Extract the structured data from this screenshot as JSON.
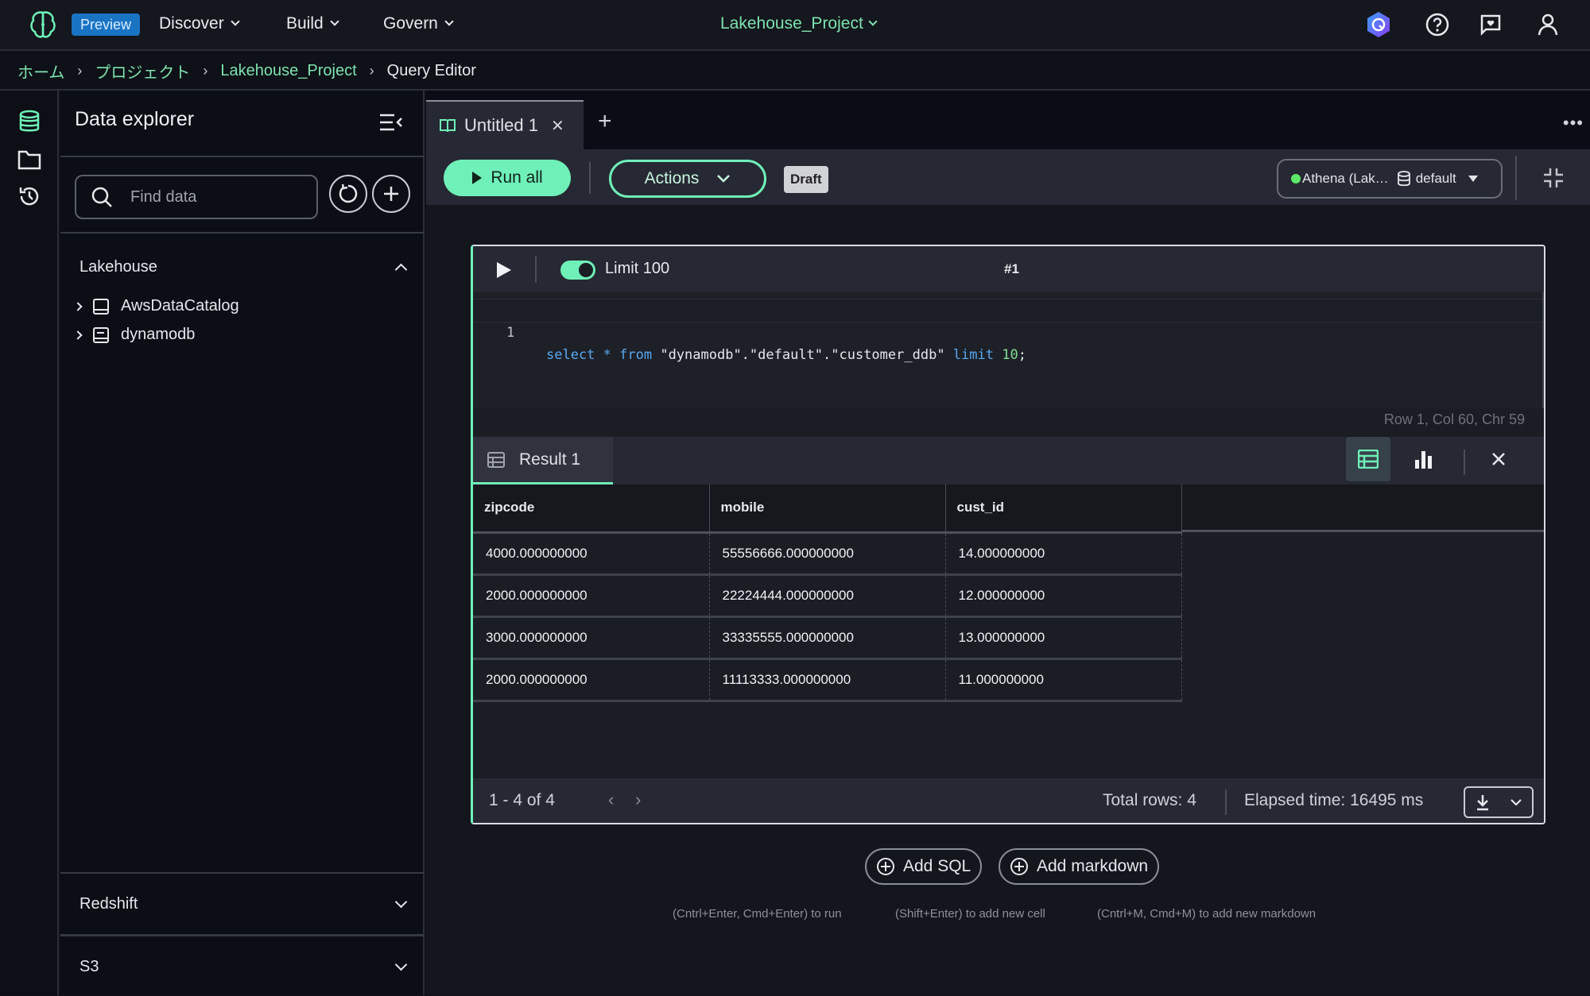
{
  "topbar": {
    "preview_badge": "Preview",
    "menus": [
      {
        "label": "Discover"
      },
      {
        "label": "Build"
      },
      {
        "label": "Govern"
      }
    ],
    "project": "Lakehouse_Project",
    "icons": [
      "app-logo-icon",
      "assistant-icon",
      "help-icon",
      "feedback-icon",
      "user-icon"
    ]
  },
  "breadcrumb": [
    {
      "label": "ホーム"
    },
    {
      "label": "プロジェクト"
    },
    {
      "label": "Lakehouse_Project"
    },
    {
      "label": "Query Editor"
    }
  ],
  "rail": {
    "icons": [
      "database-icon",
      "folder-icon",
      "history-icon"
    ],
    "active": "database-icon"
  },
  "explorer": {
    "title": "Data explorer",
    "search_placeholder": "Find data",
    "sections": [
      {
        "label": "Lakehouse",
        "expanded": true,
        "items": [
          {
            "label": "AwsDataCatalog"
          },
          {
            "label": "dynamodb"
          }
        ]
      },
      {
        "label": "Redshift",
        "expanded": false
      },
      {
        "label": "S3",
        "expanded": false
      }
    ]
  },
  "tabs": [
    {
      "label": "Untitled 1",
      "active": true
    }
  ],
  "toolbar": {
    "run_all": "Run all",
    "actions": "Actions",
    "status_badge": "Draft",
    "engine": "Athena (Lak…",
    "database": "default"
  },
  "cell": {
    "limit_enabled": true,
    "limit_label": "Limit 100",
    "cell_number": "#1",
    "code": {
      "line_number": "1",
      "tokens": {
        "kw1": "select",
        "star": " * ",
        "kw2": "from",
        "table": " \"dynamodb\".\"default\".\"customer_ddb\" ",
        "kw3": "limit",
        "num": " 10",
        "semi": ";"
      }
    },
    "cursor_position": "Row 1,  Col 60,  Chr 59",
    "result_tab": "Result 1",
    "result_view": "table",
    "table": {
      "columns": [
        "zipcode",
        "mobile",
        "cust_id"
      ],
      "rows": [
        [
          "4000.000000000",
          "55556666.000000000",
          "14.000000000"
        ],
        [
          "2000.000000000",
          "22224444.000000000",
          "12.000000000"
        ],
        [
          "3000.000000000",
          "33335555.000000000",
          "13.000000000"
        ],
        [
          "2000.000000000",
          "11113333.000000000",
          "11.000000000"
        ]
      ]
    },
    "footer": {
      "page_info": "1 - 4 of 4",
      "total_rows": "Total rows: 4",
      "elapsed": "Elapsed time: 16495 ms"
    }
  },
  "add_buttons": {
    "sql": "Add SQL",
    "markdown": "Add markdown"
  },
  "hints": [
    "(Cntrl+Enter, Cmd+Enter) to run",
    "(Shift+Enter) to add new cell",
    "(Cntrl+M, Cmd+M) to add new markdown"
  ],
  "colors": {
    "accent": "#6ff0b8",
    "link": "#7ee2b0",
    "preview": "#1a74c4",
    "keyword": "#59a8f0",
    "status_ok": "#5ee867"
  }
}
